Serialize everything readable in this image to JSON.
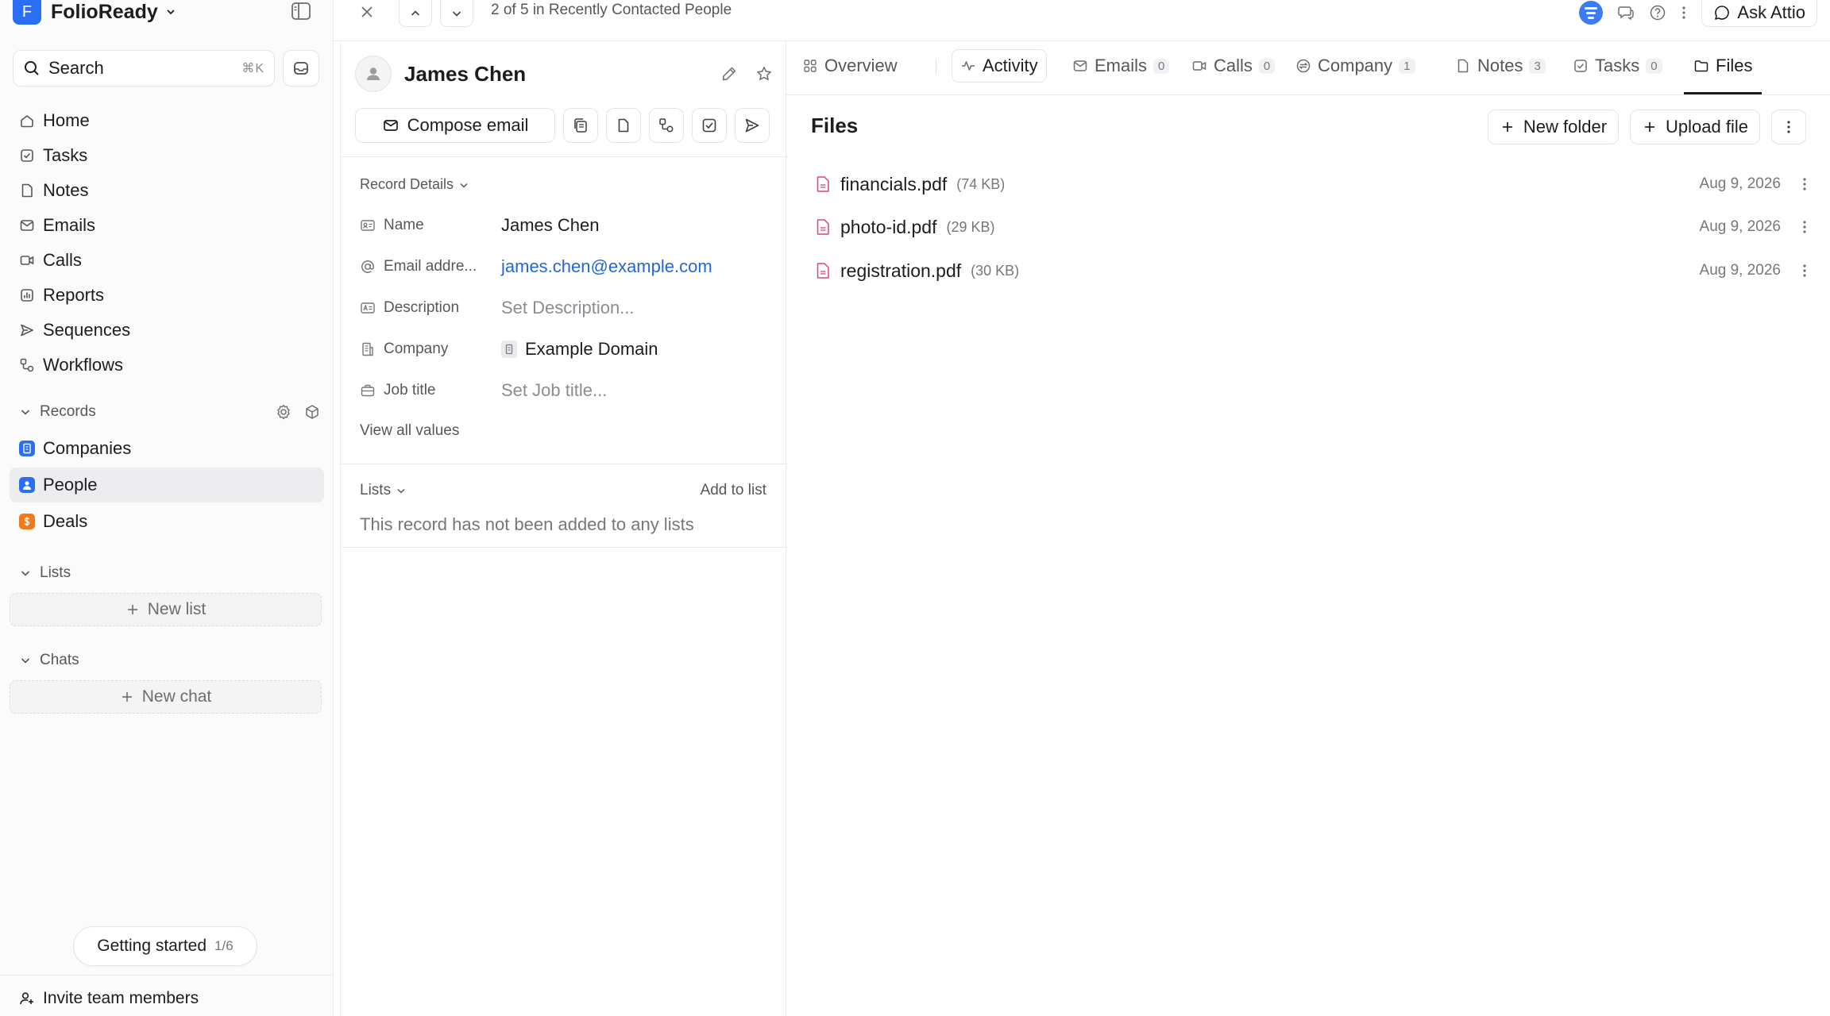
{
  "workspace": {
    "name": "FolioReady",
    "initial": "F"
  },
  "search": {
    "label": "Search",
    "shortcut": "⌘K"
  },
  "nav": [
    {
      "label": "Home",
      "icon": "home-icon"
    },
    {
      "label": "Tasks",
      "icon": "task-check-icon"
    },
    {
      "label": "Notes",
      "icon": "note-icon"
    },
    {
      "label": "Emails",
      "icon": "mail-icon"
    },
    {
      "label": "Calls",
      "icon": "video-icon"
    },
    {
      "label": "Reports",
      "icon": "chart-icon"
    },
    {
      "label": "Sequences",
      "icon": "send-icon"
    },
    {
      "label": "Workflows",
      "icon": "workflow-icon"
    }
  ],
  "records_section": {
    "title": "Records"
  },
  "records": [
    {
      "label": "Companies",
      "color": "#2a6ef5"
    },
    {
      "label": "People",
      "color": "#2a6ef5",
      "active": true
    },
    {
      "label": "Deals",
      "color": "#f07b1c"
    }
  ],
  "lists_section": {
    "title": "Lists",
    "new_label": "New list"
  },
  "chats_section": {
    "title": "Chats",
    "new_label": "New chat"
  },
  "getting_started": {
    "label": "Getting started",
    "progress": "1/6"
  },
  "invite": {
    "label": "Invite team members"
  },
  "topbar": {
    "position_text": "2 of 5 in Recently Contacted People",
    "ask_label": "Ask Attio"
  },
  "record": {
    "name": "James Chen",
    "compose_label": "Compose email",
    "details_title": "Record Details",
    "fields": {
      "name": {
        "label": "Name",
        "value": "James Chen"
      },
      "email": {
        "label": "Email addre...",
        "value": "james.chen@example.com"
      },
      "description": {
        "label": "Description",
        "value": "Set Description..."
      },
      "company": {
        "label": "Company",
        "value": "Example Domain"
      },
      "job_title": {
        "label": "Job title",
        "value": "Set Job title..."
      }
    },
    "view_all": "View all values",
    "lists_title": "Lists",
    "add_to_list": "Add to list",
    "no_lists": "This record has not been added to any lists"
  },
  "tabs": {
    "overview": {
      "label": "Overview"
    },
    "activity": {
      "label": "Activity"
    },
    "emails": {
      "label": "Emails",
      "count": "0"
    },
    "calls": {
      "label": "Calls",
      "count": "0"
    },
    "company": {
      "label": "Company",
      "count": "1"
    },
    "notes": {
      "label": "Notes",
      "count": "3"
    },
    "tasks": {
      "label": "Tasks",
      "count": "0"
    },
    "files": {
      "label": "Files"
    }
  },
  "files": {
    "title": "Files",
    "new_folder": "New folder",
    "upload": "Upload file",
    "items": [
      {
        "name": "financials.pdf",
        "size": "(74 KB)",
        "date": "Aug 9, 2026"
      },
      {
        "name": "photo-id.pdf",
        "size": "(29 KB)",
        "date": "Aug 9, 2026"
      },
      {
        "name": "registration.pdf",
        "size": "(30 KB)",
        "date": "Aug 9, 2026"
      }
    ]
  },
  "colors": {
    "accent": "#2a6ef5",
    "link": "#2466d6",
    "file_icon": "#d9467a"
  }
}
